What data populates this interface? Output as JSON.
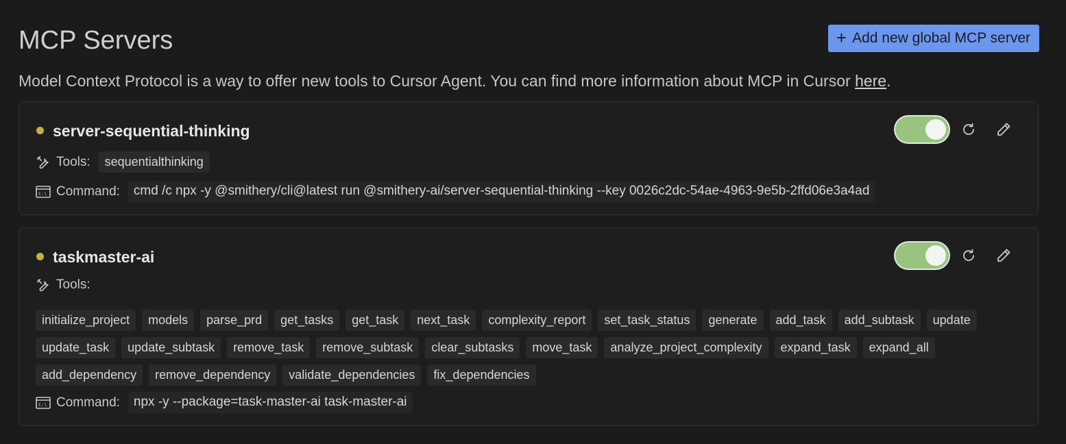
{
  "header": {
    "title": "MCP Servers",
    "add_button_label": "Add new global MCP server",
    "description_prefix": "Model Context Protocol is a way to offer new tools to Cursor Agent. You can find more information about MCP in Cursor ",
    "description_link": "here",
    "description_suffix": "."
  },
  "servers": [
    {
      "name": "server-sequential-thinking",
      "status_color": "#c8b03c",
      "enabled": true,
      "tools_label": "Tools:",
      "tools": [
        "sequentialthinking"
      ],
      "command_label": "Command:",
      "command": "cmd /c npx -y @smithery/cli@latest run @smithery-ai/server-sequential-thinking --key 0026c2dc-54ae-4963-9e5b-2ffd06e3a4ad"
    },
    {
      "name": "taskmaster-ai",
      "status_color": "#c8b03c",
      "enabled": true,
      "tools_label": "Tools:",
      "tools": [
        "initialize_project",
        "models",
        "parse_prd",
        "get_tasks",
        "get_task",
        "next_task",
        "complexity_report",
        "set_task_status",
        "generate",
        "add_task",
        "add_subtask",
        "update",
        "update_task",
        "update_subtask",
        "remove_task",
        "remove_subtask",
        "clear_subtasks",
        "move_task",
        "analyze_project_complexity",
        "expand_task",
        "expand_all",
        "add_dependency",
        "remove_dependency",
        "validate_dependencies",
        "fix_dependencies"
      ],
      "command_label": "Command:",
      "command": "npx -y --package=task-master-ai task-master-ai"
    }
  ],
  "colors": {
    "background": "#1b1b1b",
    "accent_button": "#6b97ec",
    "toggle_on": "#98c47f",
    "status_dot": "#c8b03c"
  },
  "icons": {
    "add": "plus-icon",
    "refresh": "refresh-icon",
    "edit": "pencil-icon",
    "tools": "wrench-screwdriver-icon",
    "command": "terminal-icon"
  }
}
